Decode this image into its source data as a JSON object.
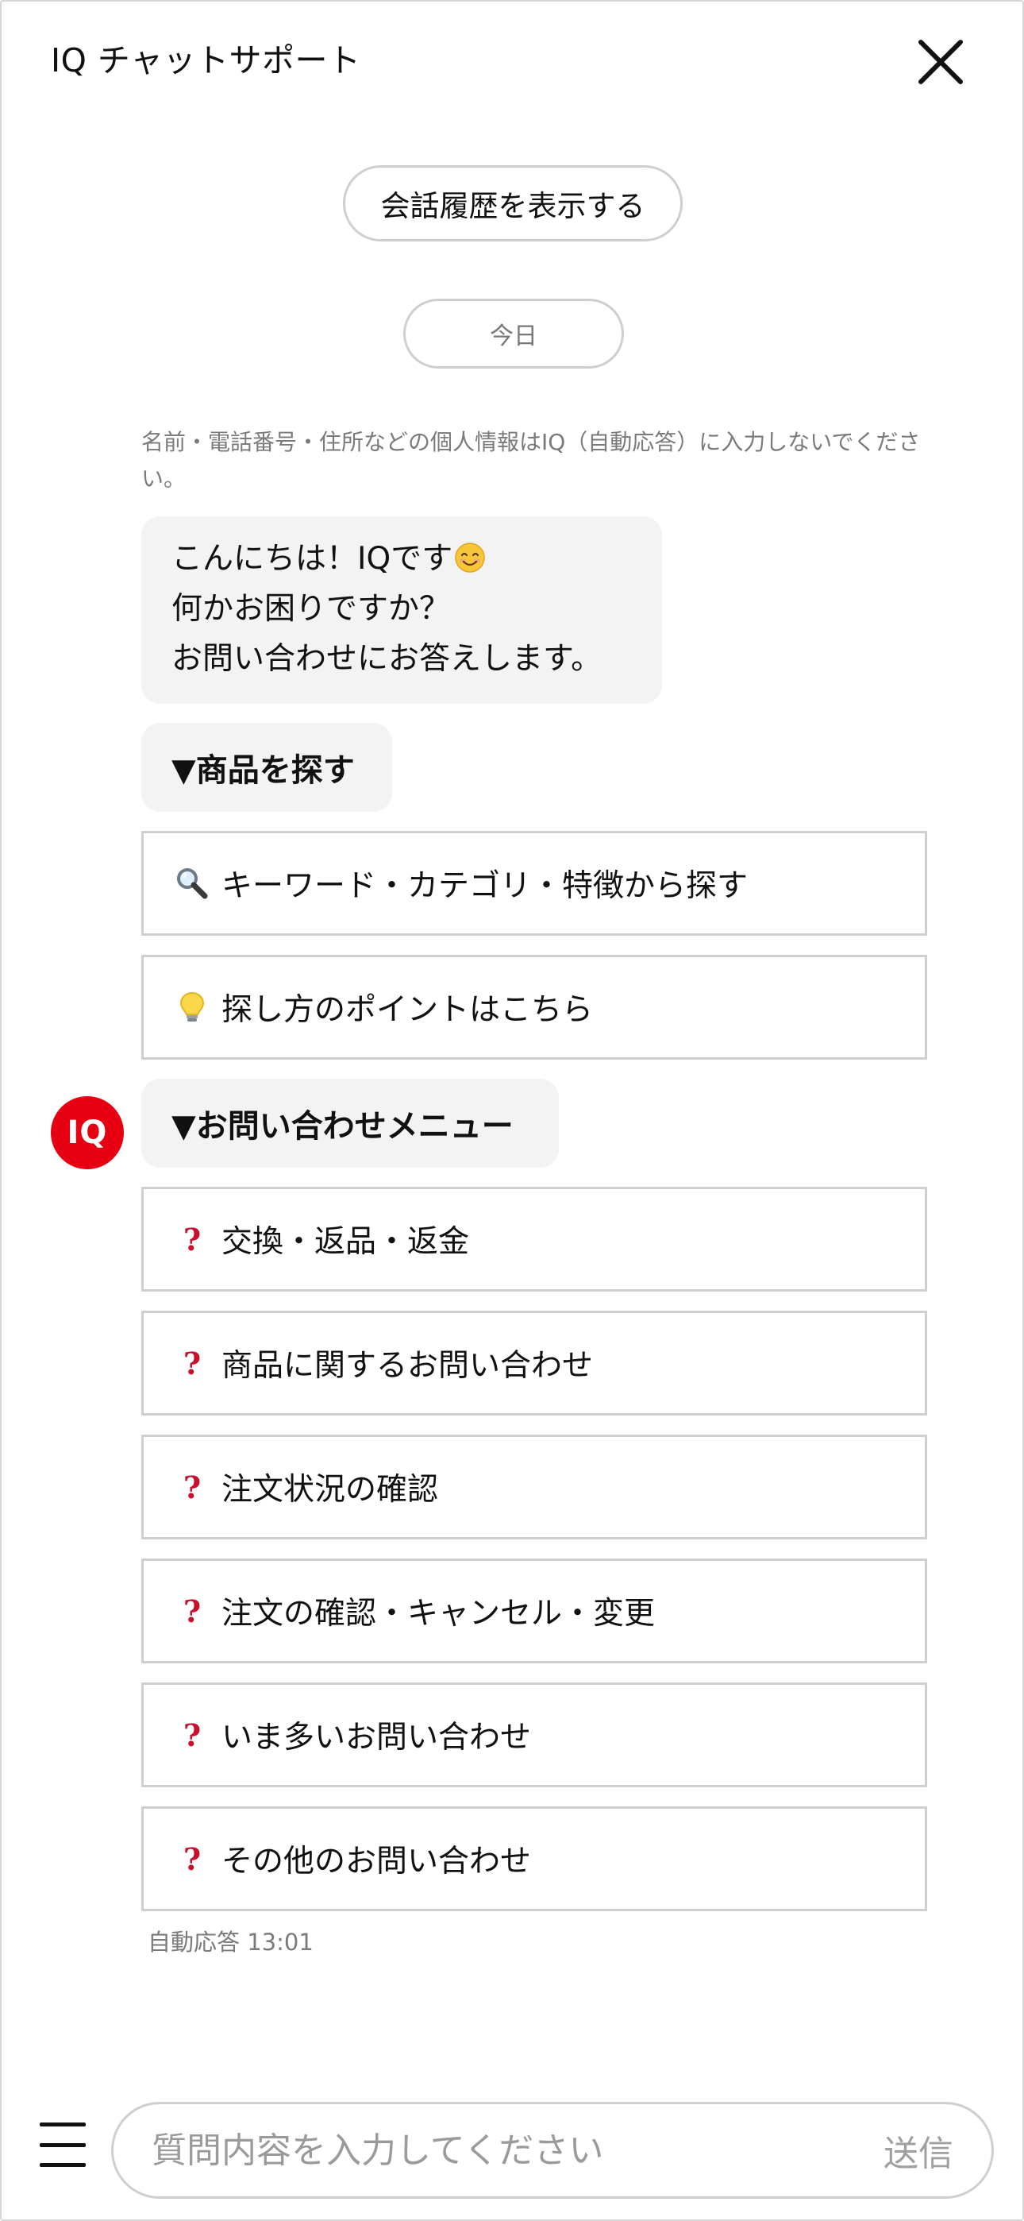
{
  "header": {
    "title": "IQ チャットサポート",
    "close_icon": "close-icon"
  },
  "chat": {
    "history_button_label": "会話履歴を表示する",
    "date_label": "今日",
    "notice": "名前・電話番号・住所などの個人情報はIQ（自動応答）に入力しないでください。",
    "greeting": {
      "lines": [
        "こんにちは！IQです",
        "何かお困りですか？",
        "お問い合わせにお答えします。"
      ],
      "emoji": "smiling-face-icon"
    },
    "product_section": {
      "title": "▼商品を探す",
      "options": [
        {
          "icon": "magnifier-icon",
          "label": "キーワード・カテゴリ・特徴から探す"
        },
        {
          "icon": "lightbulb-icon",
          "label": "探し方のポイントはこちら"
        }
      ]
    },
    "bot_avatar_label": "IQ",
    "inquiry_section": {
      "title": "▼お問い合わせメニュー",
      "question_mark": "?",
      "options": [
        {
          "label": "交換・返品・返金"
        },
        {
          "label": "商品に関するお問い合わせ"
        },
        {
          "label": "注文状況の確認"
        },
        {
          "label": "注文の確認・キャンセル・変更"
        },
        {
          "label": "いま多いお問い合わせ"
        },
        {
          "label": "その他のお問い合わせ"
        }
      ]
    },
    "timestamp": "自動応答 13:01"
  },
  "composer": {
    "menu_icon": "hamburger-menu-icon",
    "placeholder": "質問内容を入力してください",
    "value": "",
    "send_label": "送信"
  },
  "colors": {
    "accent_red": "#e60012",
    "question_red": "#c8102e",
    "bubble_bg": "#f3f3f3",
    "border": "#cfcfcf"
  }
}
